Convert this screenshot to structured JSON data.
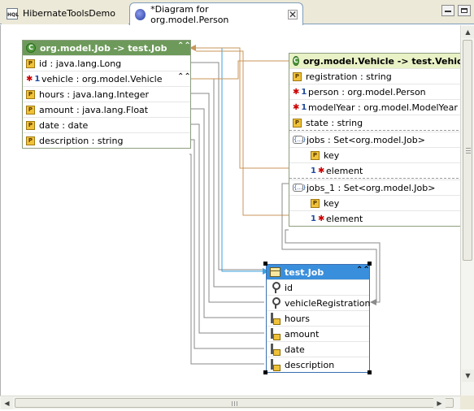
{
  "tabs": [
    {
      "label": "HibernateToolsDemo",
      "icon": "hql-file-icon",
      "active": false
    },
    {
      "label": "*Diagram for org.model.Person",
      "icon": "diagram-icon",
      "active": true
    }
  ],
  "hql_icon_text": "HQL",
  "close_glyph": "✕",
  "job_entity": {
    "title": "org.model.Job -> test.Job",
    "icon_text": "C",
    "fields": [
      {
        "icon": "P",
        "label": "id : java.lang.Long"
      },
      {
        "icon": "rel",
        "label": "vehicle : org.model.Vehicle"
      },
      {
        "icon": "P",
        "label": "hours : java.lang.Integer"
      },
      {
        "icon": "P",
        "label": "amount : java.lang.Float"
      },
      {
        "icon": "P",
        "label": "date : date"
      },
      {
        "icon": "P",
        "label": "description : string"
      }
    ]
  },
  "vehicle_entity": {
    "title": "org.model.Vehicle -> test.Vehicle",
    "icon_text": "C",
    "fields": [
      {
        "icon": "P",
        "label": "registration : string"
      },
      {
        "icon": "rel",
        "label": "person : org.model.Person"
      },
      {
        "icon": "rel",
        "label": "modelYear : org.model.ModelYear"
      },
      {
        "icon": "P",
        "label": "state : string"
      }
    ],
    "collections": [
      {
        "label": "jobs : Set<org.model.Job>",
        "set_icon": "{...}",
        "sub": [
          {
            "icon": "P",
            "label": "key"
          },
          {
            "icon": "rel-one",
            "label": "element"
          }
        ]
      },
      {
        "label": "jobs_1 : Set<org.model.Job>",
        "set_icon": "{...}",
        "sub": [
          {
            "icon": "P",
            "label": "key"
          },
          {
            "icon": "rel-one",
            "label": "element"
          }
        ]
      }
    ]
  },
  "job_table": {
    "title": "test.Job",
    "columns": [
      {
        "label": "id",
        "key": true
      },
      {
        "label": "vehicleRegistration",
        "key": true
      },
      {
        "label": "hours",
        "key": false
      },
      {
        "label": "amount",
        "key": false
      },
      {
        "label": "date",
        "key": false
      },
      {
        "label": "description",
        "key": false
      }
    ]
  },
  "glyphs": {
    "collapse": "⌃⌃",
    "arrow_up": "▲",
    "arrow_down": "▼",
    "arrow_left": "◀",
    "arrow_right": "▶"
  },
  "colors": {
    "entity_header": "#6d9a5a",
    "vehicle_header": "#e9f2c6",
    "table_header": "#3a8fdc",
    "connector_gray": "#8a8a8a",
    "connector_orange": "#c8965a",
    "connector_blue": "#3aa0e0"
  }
}
